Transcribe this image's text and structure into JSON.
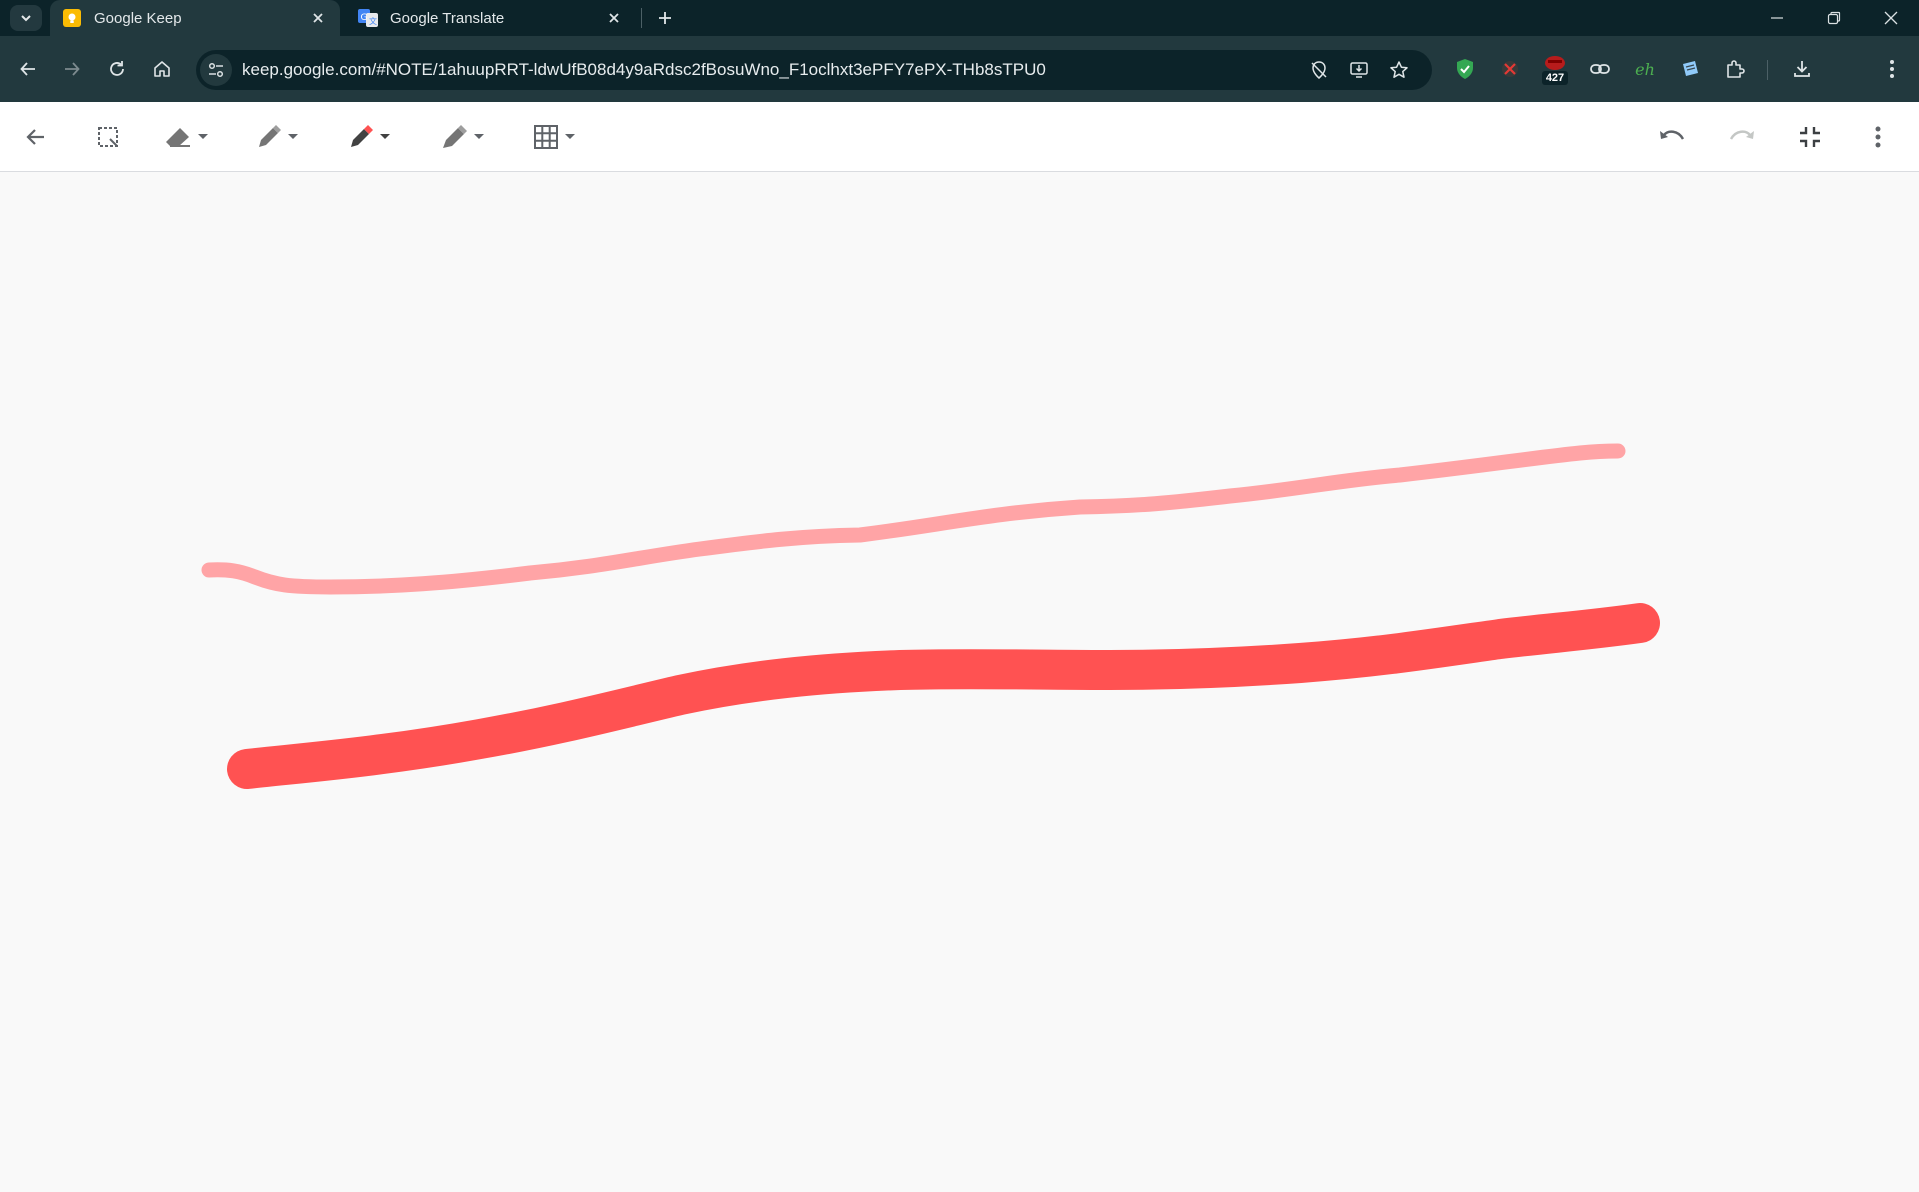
{
  "browser": {
    "tabs": [
      {
        "title": "Google Keep",
        "active": true,
        "icon": "keep-favicon-icon"
      },
      {
        "title": "Google Translate",
        "active": false,
        "icon": "translate-favicon-icon"
      }
    ],
    "url": "keep.google.com/#NOTE/1ahuupRRT-ldwUfB08d4y9aRdsc2fBosuWno_F1oclhxt3ePFY7ePX-THb8sTPU0",
    "extensions": [
      {
        "name": "shield-extension-icon",
        "color": "#34a853"
      },
      {
        "name": "blocker-extension-icon",
        "color": "#e53935"
      },
      {
        "name": "counter-extension-icon",
        "badge": "427",
        "color": "#b71c1c"
      },
      {
        "name": "link-extension-icon"
      },
      {
        "name": "eh-extension-icon",
        "label": "eh",
        "color": "#4caf50"
      },
      {
        "name": "note-extension-icon",
        "color": "#90caf9"
      },
      {
        "name": "extensions-puzzle-icon"
      }
    ]
  },
  "keep_toolbar": {
    "tools": [
      "back-arrow-icon",
      "select-tool-icon",
      "eraser-tool-icon",
      "pen-tool-icon",
      "marker-tool-icon",
      "highlighter-tool-icon",
      "grid-tool-icon"
    ],
    "actions": [
      "undo-icon",
      "redo-icon",
      "exit-fullscreen-icon",
      "more-options-icon"
    ],
    "active_marker_color": "#ff5252"
  },
  "canvas": {
    "strokes": [
      {
        "name": "thin-pink-stroke",
        "color": "#ffa4a6",
        "tool": "pen"
      },
      {
        "name": "thick-red-stroke",
        "color": "#ff5252",
        "tool": "marker"
      }
    ]
  }
}
